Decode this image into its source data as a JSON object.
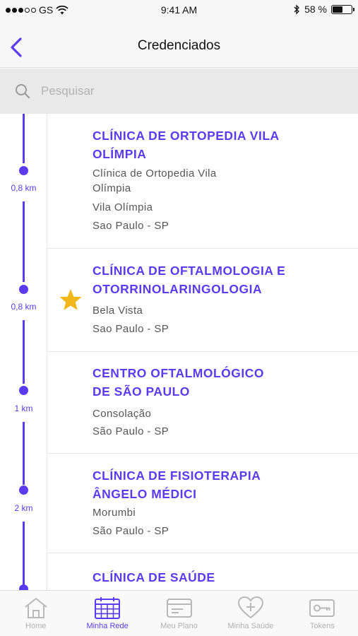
{
  "status": {
    "carrier": "GS",
    "time": "9:41 AM",
    "battery": "58 %",
    "battery_level": 0.58
  },
  "nav": {
    "title": "Credenciados",
    "back_icon": "chevron-left-icon"
  },
  "search": {
    "placeholder": "Pesquisar",
    "value": ""
  },
  "colors": {
    "accent": "#5b3bf0",
    "star": "#f2b81b"
  },
  "list": {
    "items": [
      {
        "title_1": "CLÍNICA DE ORTOPEDIA VILA",
        "title_2": "OLÍMPIA",
        "line_1": "Clínica de Ortopedia Vila",
        "line_2": "Olímpia",
        "line_3": "Vila Olímpia",
        "line_4": "Sao Paulo - SP",
        "distance": "0,8 km",
        "favorite": false
      },
      {
        "title_1": "CLÍNICA DE OFTALMOLOGIA E",
        "title_2": "OTORRINOLARINGOLOGIA",
        "line_1": "Bela Vista",
        "line_2": "Sao Paulo - SP",
        "distance": "0,8 km",
        "favorite": true
      },
      {
        "title_1": "CENTRO OFTALMOLÓGICO",
        "title_2": "DE SÃO PAULO",
        "line_1": "Consolação",
        "line_2": "São Paulo - SP",
        "distance": "1 km",
        "favorite": false
      },
      {
        "title_1": "CLÍNICA DE FISIOTERAPIA",
        "title_2": "ÂNGELO MÉDICI",
        "line_1": "Morumbi",
        "line_2": "São Paulo - SP",
        "distance": "2 km",
        "favorite": false
      },
      {
        "title_1": "CLÍNICA DE SAÚDE"
      }
    ]
  },
  "tabs": [
    {
      "label": "Home",
      "icon": "home-icon",
      "active": false
    },
    {
      "label": "Minha Rede",
      "icon": "calendar-grid-icon",
      "active": true
    },
    {
      "label": "Meu Plano",
      "icon": "card-icon",
      "active": false
    },
    {
      "label": "Minha Saúde",
      "icon": "heart-plus-icon",
      "active": false
    },
    {
      "label": "Tokens",
      "icon": "key-icon",
      "active": false
    }
  ]
}
